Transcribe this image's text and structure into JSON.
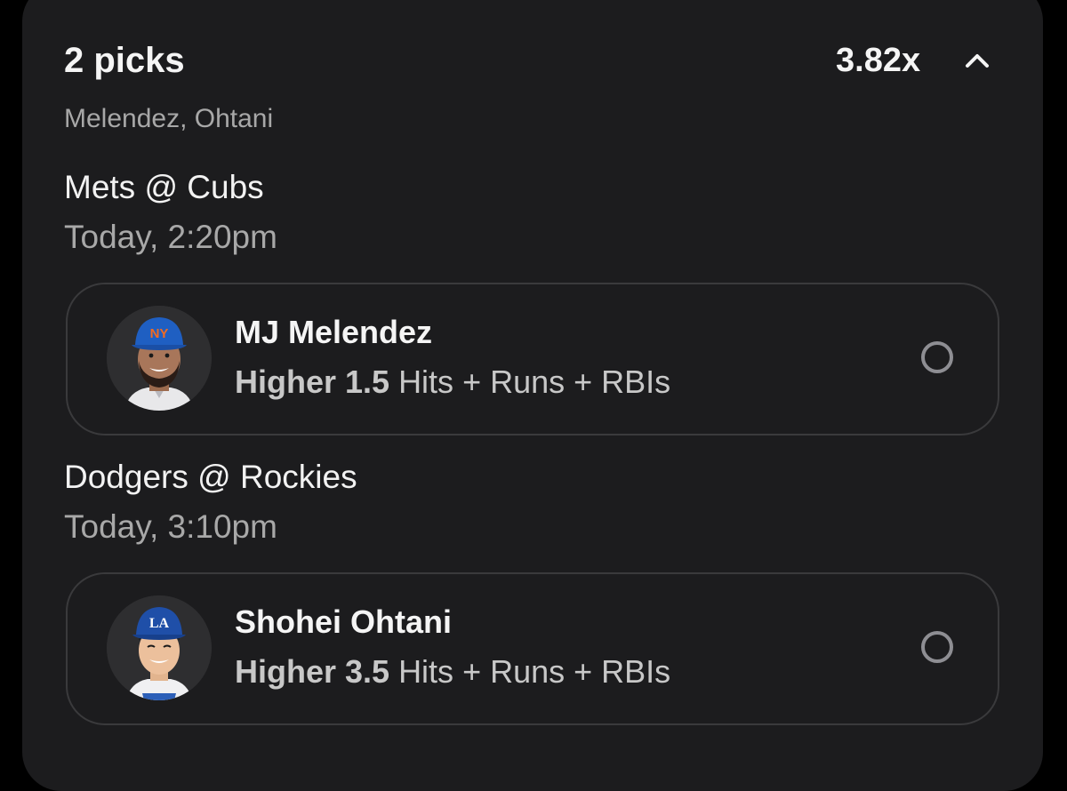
{
  "header": {
    "title": "2 picks",
    "multiplier": "3.82x",
    "players_summary": "Melendez, Ohtani"
  },
  "games": [
    {
      "matchup": "Mets @ Cubs",
      "time": "Today, 2:20pm",
      "pick": {
        "player_name": "MJ Melendez",
        "direction": "Higher",
        "line": "1.5",
        "direction_line": "Higher 1.5",
        "stat": "Hits + Runs + RBIs",
        "team_logo": "NY",
        "cap_color": "#1f5fc2",
        "avatar_icon": "player-headshot-icon"
      }
    },
    {
      "matchup": "Dodgers @ Rockies",
      "time": "Today, 3:10pm",
      "pick": {
        "player_name": "Shohei Ohtani",
        "direction": "Higher",
        "line": "3.5",
        "direction_line": "Higher 3.5",
        "stat": "Hits + Runs + RBIs",
        "team_logo": "LA",
        "cap_color": "#1f4fa8",
        "avatar_icon": "player-headshot-icon"
      }
    }
  ],
  "colors": {
    "background": "#000000",
    "card": "#1c1c1e",
    "border": "#3a3a3c",
    "text_primary": "#f5f5f5",
    "text_secondary": "#a8a8a8",
    "radio": "#8e8e93"
  }
}
